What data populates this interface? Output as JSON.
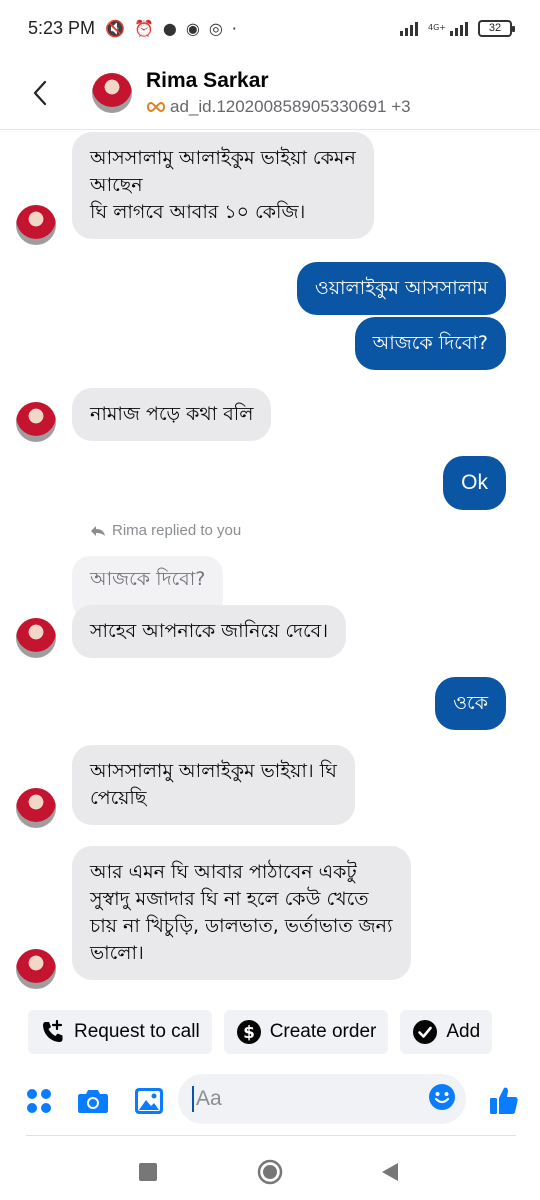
{
  "status": {
    "time": "5:23 PM",
    "net_label": "4G+",
    "battery": "32"
  },
  "header": {
    "name": "Rima Sarkar",
    "subtitle": "ad_id.120200858905330691 +3"
  },
  "messages": {
    "m1": {
      "line1": "আসসালামু আলাইকুম ভাইয়া কেমন",
      "line2": "আছেন",
      "line3": "ঘি লাগবে আবার ১০ কেজি।"
    },
    "m2": "ওয়ালাইকুম আসসালাম",
    "m3": "আজকে দিবো?",
    "m4": "নামাজ পড়ে কথা বলি",
    "m5": "Ok",
    "reply_label": "Rima replied to you",
    "quoted": "আজকে দিবো?",
    "m6": "সাহেব আপনাকে জানিয়ে দেবে।",
    "m7": "ওকে",
    "m8": {
      "line1": "আসসালামু আলাইকুম ভাইয়া। ঘি",
      "line2": "পেয়েছি"
    },
    "m9": {
      "line1": "আর এমন ঘি আবার পাঠাবেন একটু",
      "line2": "সুস্বাদু মজাদার ঘি না হলে কেউ খেতে",
      "line3": "চায় না খিচুড়ি, ডালভাত, ভর্তাভাত জন্য",
      "line4": "ভালো।"
    }
  },
  "actions": {
    "request_call": "Request to call",
    "create_order": "Create order",
    "add": "Add"
  },
  "composer": {
    "placeholder": "Aa"
  },
  "colors": {
    "brand_blue": "#0b56a4",
    "bubble_gray": "#e9e9eb",
    "icon_blue": "#0a7cff"
  },
  "icons": [
    "back-arrow-icon",
    "meta-infinity-icon",
    "phone-plus-icon",
    "dollar-icon",
    "check-circle-icon",
    "apps-icon",
    "camera-icon",
    "image-icon",
    "emoji-icon",
    "thumbs-up-icon",
    "square-nav-icon",
    "home-circle-icon",
    "back-triangle-icon"
  ]
}
